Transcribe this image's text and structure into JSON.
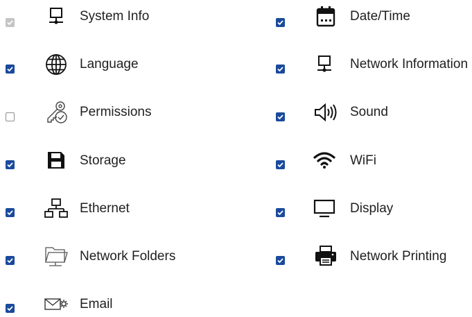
{
  "settings": {
    "left": [
      {
        "label": "System Info",
        "state": "disabled-checked",
        "icon": "monitor-icon"
      },
      {
        "label": "Language",
        "state": "checked",
        "icon": "globe-icon"
      },
      {
        "label": "Permissions",
        "state": "unchecked",
        "icon": "key-shield-icon"
      },
      {
        "label": "Storage",
        "state": "checked",
        "icon": "floppy-disk-icon"
      },
      {
        "label": "Ethernet",
        "state": "checked",
        "icon": "ethernet-network-icon"
      },
      {
        "label": "Network Folders",
        "state": "checked",
        "icon": "network-folder-icon"
      },
      {
        "label": "Email",
        "state": "checked",
        "icon": "email-gear-icon"
      }
    ],
    "right": [
      {
        "label": "Date/Time",
        "state": "checked",
        "icon": "calendar-icon"
      },
      {
        "label": "Network Information",
        "state": "checked",
        "icon": "network-computer-icon"
      },
      {
        "label": "Sound",
        "state": "checked",
        "icon": "speaker-icon"
      },
      {
        "label": "WiFi",
        "state": "checked",
        "icon": "wifi-icon"
      },
      {
        "label": "Display",
        "state": "checked",
        "icon": "display-icon"
      },
      {
        "label": "Network Printing",
        "state": "checked",
        "icon": "printer-icon"
      }
    ]
  },
  "colors": {
    "checkbox_checked": "#1a4a9c",
    "checkbox_disabled": "#c4c4c4",
    "text": "#1f1f1f"
  }
}
